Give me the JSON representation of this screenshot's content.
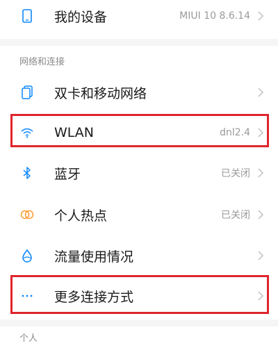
{
  "device": {
    "label": "我的设备",
    "value": "MIUI 10 8.6.14"
  },
  "sections": {
    "network_header": "网络和连接",
    "personal_header": "个人"
  },
  "items": {
    "dual_sim": {
      "label": "双卡和移动网络",
      "value": ""
    },
    "wlan": {
      "label": "WLAN",
      "value": "dnl2.4"
    },
    "bluetooth": {
      "label": "蓝牙",
      "value": "已关闭"
    },
    "hotspot": {
      "label": "个人热点",
      "value": "已关闭"
    },
    "data_usage": {
      "label": "流量使用情况",
      "value": ""
    },
    "more_connections": {
      "label": "更多连接方式",
      "value": ""
    }
  },
  "colors": {
    "accent": "#0a87ff",
    "highlight": "#e0242c",
    "hotspot": "#ff9a2e"
  }
}
